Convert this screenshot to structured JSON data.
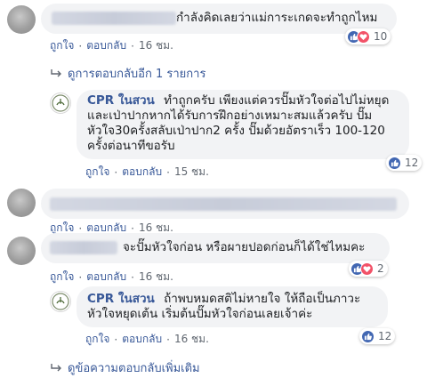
{
  "labels": {
    "like": "ถูกใจ",
    "reply": "ตอบกลับ",
    "dot": "·"
  },
  "comments": [
    {
      "text": "กำลังคิดเลยว่าแม่การะเกดจะทำถูกไหม",
      "time": "16 ชม.",
      "reaction_count": "10",
      "reactions": [
        "like-icon",
        "love-icon"
      ]
    },
    {
      "author": "CPR ในสวน",
      "text": "ทำถูกครับ เพียงแต่ควรปั๊มหัวใจต่อไปไม่หยุด และเป่าปากหากได้รับการฝึกอย่างเหมาะสมแล้วครับ ปั๊มหัวใจ30ครั้งสลับเป่าปาก2 ครั้ง ปั๊มด้วยอัตราเร็ว 100-120 ครั้งต่อนาทีขอรับ",
      "time": "15 ชม.",
      "reaction_count": "12",
      "reactions": [
        "like-icon"
      ]
    },
    {
      "text": "",
      "time": "16 ชม."
    },
    {
      "text": "จะปั๊มหัวใจก่อน หรือผายปอดก่อนก็ได้ใช่ไหมคะ",
      "time": "16 ชม.",
      "reaction_count": "2",
      "reactions": [
        "like-icon",
        "love-icon"
      ]
    },
    {
      "author": "CPR ในสวน",
      "text": "ถ้าพบหมดสติไม่หายใจ ให้ถือเป็นภาวะหัวใจหยุดเต้น เริ่มต้นปั๊มหัวใจก่อนเลยเจ้าค่ะ",
      "time": "16 ชม.",
      "reaction_count": "12",
      "reactions": [
        "like-icon"
      ]
    }
  ],
  "more_replies": "ดูการตอบกลับอีก 1 รายการ",
  "more_comments": "ดูข้อความตอบกลับเพิ่มเติม",
  "colors": {
    "link": "#385898",
    "bubble": "#f2f3f5",
    "like": "#4267b2",
    "love": "#f25268",
    "meta": "#606770"
  }
}
